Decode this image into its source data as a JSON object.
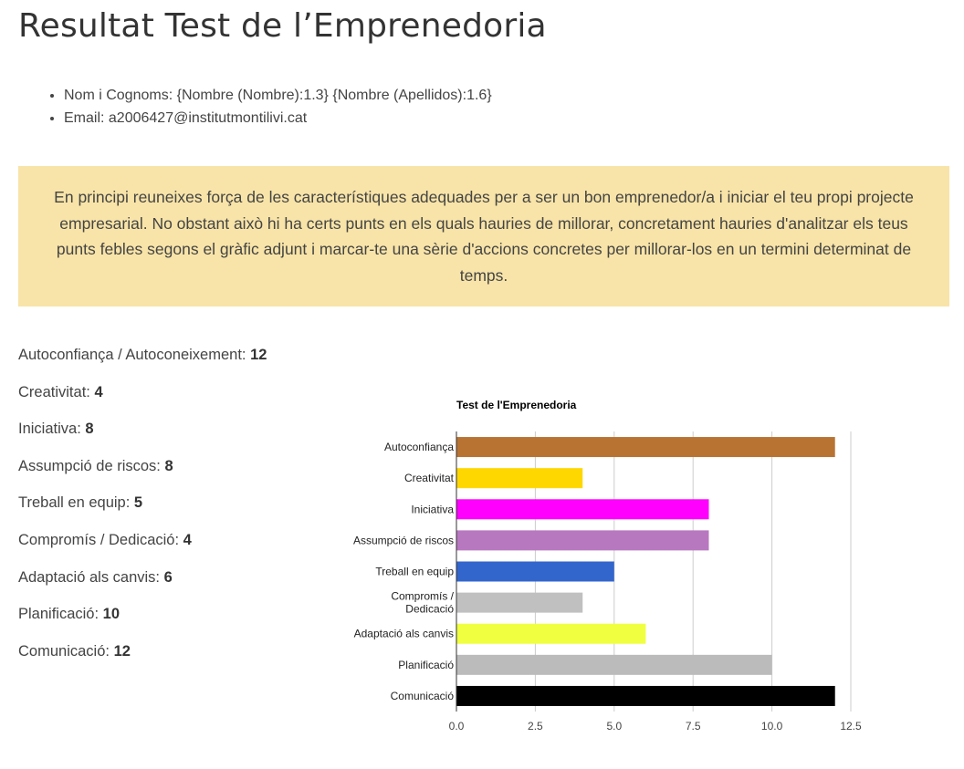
{
  "page": {
    "title": "Resultat Test de l’Emprenedoria"
  },
  "info": {
    "name_label": "Nom i Cognoms:",
    "name_value": "{Nombre (Nombre):1.3} {Nombre (Apellidos):1.6}",
    "email_label": "Email:",
    "email_value": "a2006427@institutmontilivi.cat"
  },
  "alert": {
    "text": "En principi reuneixes força de les característiques adequades per a ser un bon emprenedor/a i iniciar el teu propi projecte empresarial. No obstant això hi ha certs punts en els quals hauries de millorar, concretament hauries d'analitzar els teus punts febles segons el gràfic adjunt i marcar-te una sèrie d'accions concretes per millorar-los en un termini determinat de temps.",
    "background": "#f8e4a8"
  },
  "scores": [
    {
      "label": "Autoconfiança / Autoconeixement:",
      "value": "12"
    },
    {
      "label": "Creativitat:",
      "value": "4"
    },
    {
      "label": "Iniciativa:",
      "value": "8"
    },
    {
      "label": "Assumpció de riscos:",
      "value": "8"
    },
    {
      "label": "Treball en equip:",
      "value": "5"
    },
    {
      "label": "Compromís / Dedicació:",
      "value": "4"
    },
    {
      "label": "Adaptació als canvis:",
      "value": "6"
    },
    {
      "label": "Planificació:",
      "value": "10"
    },
    {
      "label": "Comunicació:",
      "value": "12"
    }
  ],
  "chart_data": {
    "type": "bar",
    "orientation": "horizontal",
    "title": "Test de l'Emprenedoria",
    "categories": [
      "Autoconfiança",
      "Creativitat",
      "Iniciativa",
      "Assumpció de riscos",
      "Treball en equip",
      "Compromís / Dedicació",
      "Adaptació als canvis",
      "Planificació",
      "Comunicació"
    ],
    "values": [
      12,
      4,
      8,
      8,
      5,
      4,
      6,
      10,
      12
    ],
    "colors": [
      "#b87333",
      "#ffd700",
      "#ff00ff",
      "#b878c0",
      "#3366cc",
      "#c0c0c0",
      "#f0ff40",
      "#bbbbbb",
      "#000000"
    ],
    "xlim": [
      0,
      12.5
    ],
    "xticks": [
      "0.0",
      "2.5",
      "5.0",
      "7.5",
      "10.0",
      "12.5"
    ],
    "xtick_values": [
      0,
      2.5,
      5,
      7.5,
      10,
      12.5
    ],
    "grid": true,
    "legend": "none"
  }
}
